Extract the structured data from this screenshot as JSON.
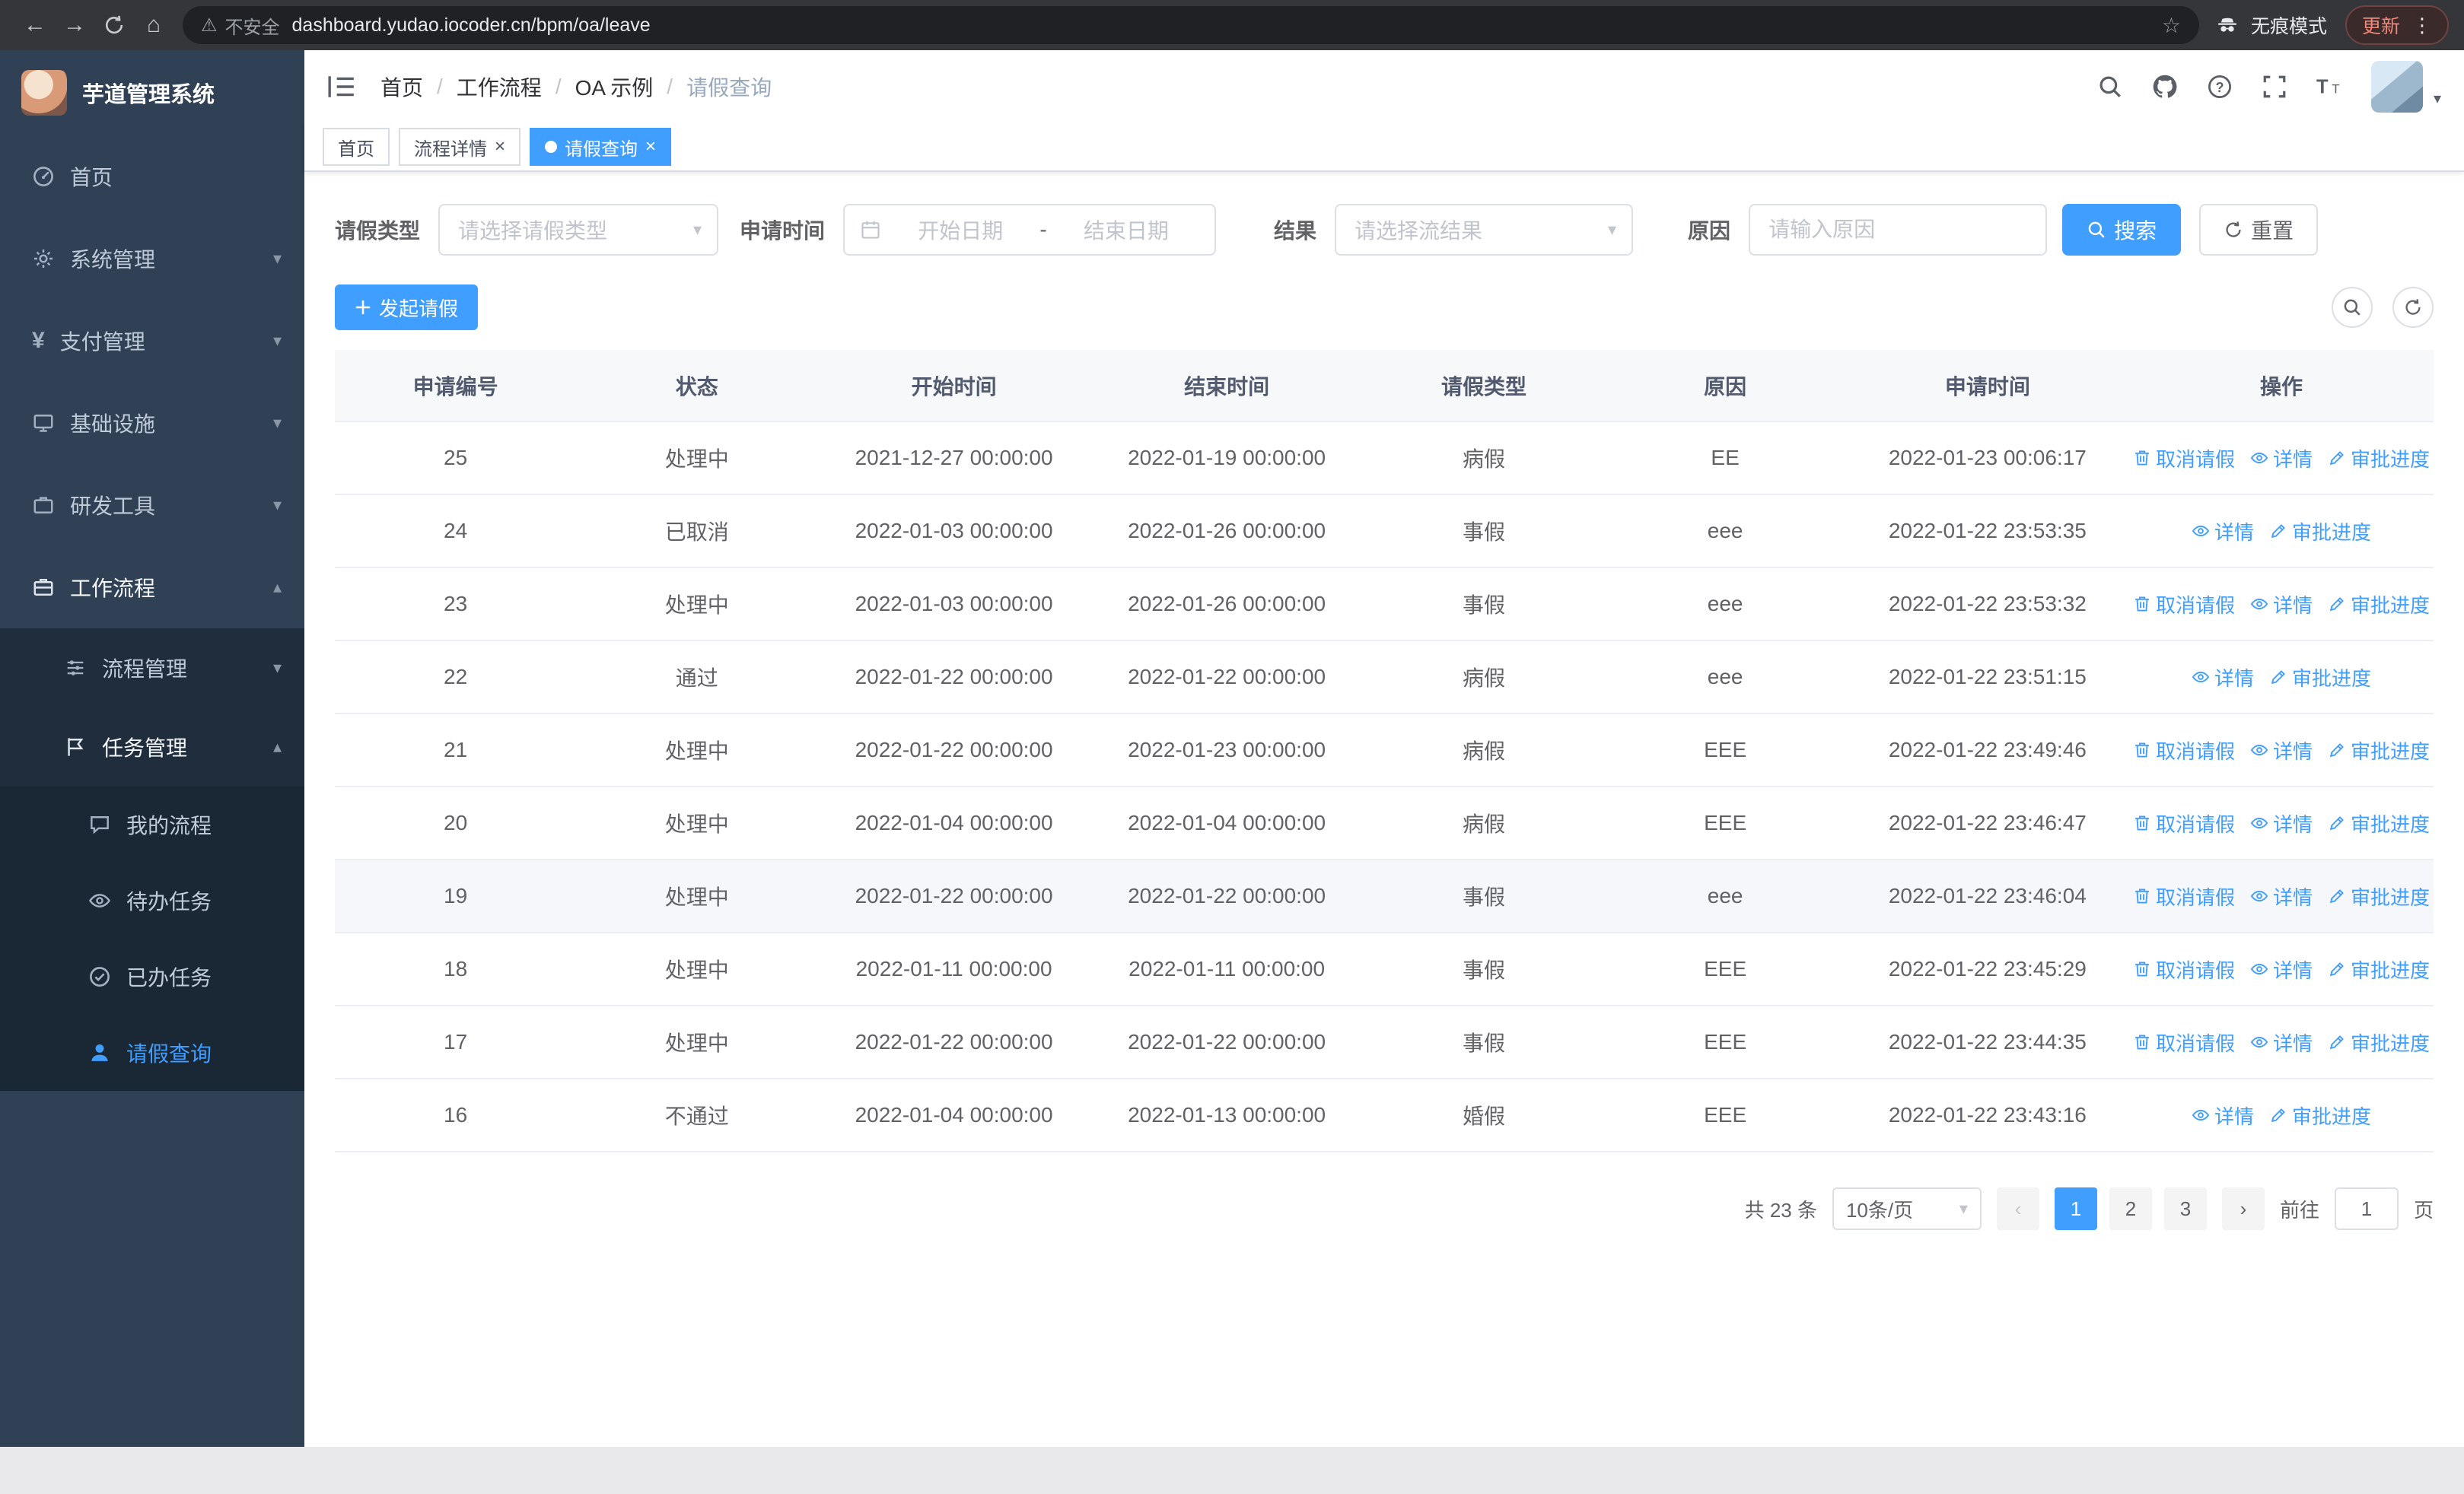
{
  "browser": {
    "security_warning": "不安全",
    "url": "dashboard.yudao.iocoder.cn/bpm/oa/leave",
    "incognito_label": "无痕模式",
    "update_label": "更新"
  },
  "sidebar": {
    "logo_title": "芋道管理系统",
    "menu": [
      {
        "key": "home",
        "label": "首页",
        "icon": "dashboard"
      },
      {
        "key": "system",
        "label": "系统管理",
        "icon": "gear",
        "chevron": "down"
      },
      {
        "key": "payment",
        "label": "支付管理",
        "icon": "yen",
        "chevron": "down"
      },
      {
        "key": "infrastructure",
        "label": "基础设施",
        "icon": "infrastructure",
        "chevron": "down"
      },
      {
        "key": "devtools",
        "label": "研发工具",
        "icon": "devtools",
        "chevron": "down"
      },
      {
        "key": "workflow",
        "label": "工作流程",
        "icon": "workflow",
        "chevron": "up",
        "open": true
      }
    ],
    "workflow_submenu": [
      {
        "key": "process-mgmt",
        "label": "流程管理",
        "icon": "process",
        "chevron": "down"
      },
      {
        "key": "task-mgmt",
        "label": "任务管理",
        "icon": "task",
        "chevron": "up",
        "open": true
      }
    ],
    "task_children": [
      {
        "key": "my-processes",
        "label": "我的流程",
        "icon": "chat"
      },
      {
        "key": "todo-tasks",
        "label": "待办任务",
        "icon": "eye"
      },
      {
        "key": "done-tasks",
        "label": "已办任务",
        "icon": "done"
      },
      {
        "key": "leave-query",
        "label": "请假查询",
        "icon": "user",
        "active": true
      }
    ]
  },
  "header": {
    "breadcrumb": [
      "首页",
      "工作流程",
      "OA 示例",
      "请假查询"
    ]
  },
  "tabs": [
    {
      "key": "home",
      "label": "首页"
    },
    {
      "key": "process-detail",
      "label": "流程详情",
      "closable": true
    },
    {
      "key": "leave-query",
      "label": "请假查询",
      "closable": true,
      "active": true
    }
  ],
  "filters": {
    "leave_type_label": "请假类型",
    "leave_type_placeholder": "请选择请假类型",
    "apply_time_label": "申请时间",
    "start_date_placeholder": "开始日期",
    "range_separator": "-",
    "end_date_placeholder": "结束日期",
    "result_label": "结果",
    "result_placeholder": "请选择流结果",
    "reason_label": "原因",
    "reason_placeholder": "请输入原因",
    "search_button": "搜索",
    "reset_button": "重置"
  },
  "toolbar": {
    "create_button": "发起请假"
  },
  "table": {
    "columns": [
      "申请编号",
      "状态",
      "开始时间",
      "结束时间",
      "请假类型",
      "原因",
      "申请时间",
      "操作"
    ],
    "actions": {
      "cancel": "取消请假",
      "detail": "详情",
      "progress": "审批进度"
    },
    "rows": [
      {
        "id": "25",
        "status": "处理中",
        "start": "2021-12-27 00:00:00",
        "end": "2022-01-19 00:00:00",
        "type": "病假",
        "reason": "EE",
        "applied": "2022-01-23 00:06:17",
        "cancellable": true
      },
      {
        "id": "24",
        "status": "已取消",
        "start": "2022-01-03 00:00:00",
        "end": "2022-01-26 00:00:00",
        "type": "事假",
        "reason": "eee",
        "applied": "2022-01-22 23:53:35",
        "cancellable": false
      },
      {
        "id": "23",
        "status": "处理中",
        "start": "2022-01-03 00:00:00",
        "end": "2022-01-26 00:00:00",
        "type": "事假",
        "reason": "eee",
        "applied": "2022-01-22 23:53:32",
        "cancellable": true
      },
      {
        "id": "22",
        "status": "通过",
        "start": "2022-01-22 00:00:00",
        "end": "2022-01-22 00:00:00",
        "type": "病假",
        "reason": "eee",
        "applied": "2022-01-22 23:51:15",
        "cancellable": false
      },
      {
        "id": "21",
        "status": "处理中",
        "start": "2022-01-22 00:00:00",
        "end": "2022-01-23 00:00:00",
        "type": "病假",
        "reason": "EEE",
        "applied": "2022-01-22 23:49:46",
        "cancellable": true
      },
      {
        "id": "20",
        "status": "处理中",
        "start": "2022-01-04 00:00:00",
        "end": "2022-01-04 00:00:00",
        "type": "病假",
        "reason": "EEE",
        "applied": "2022-01-22 23:46:47",
        "cancellable": true
      },
      {
        "id": "19",
        "status": "处理中",
        "start": "2022-01-22 00:00:00",
        "end": "2022-01-22 00:00:00",
        "type": "事假",
        "reason": "eee",
        "applied": "2022-01-22 23:46:04",
        "cancellable": true,
        "hover": true
      },
      {
        "id": "18",
        "status": "处理中",
        "start": "2022-01-11 00:00:00",
        "end": "2022-01-11 00:00:00",
        "type": "事假",
        "reason": "EEE",
        "applied": "2022-01-22 23:45:29",
        "cancellable": true
      },
      {
        "id": "17",
        "status": "处理中",
        "start": "2022-01-22 00:00:00",
        "end": "2022-01-22 00:00:00",
        "type": "事假",
        "reason": "EEE",
        "applied": "2022-01-22 23:44:35",
        "cancellable": true
      },
      {
        "id": "16",
        "status": "不通过",
        "start": "2022-01-04 00:00:00",
        "end": "2022-01-13 00:00:00",
        "type": "婚假",
        "reason": "EEE",
        "applied": "2022-01-22 23:43:16",
        "cancellable": false
      }
    ]
  },
  "pagination": {
    "total_text": "共 23 条",
    "page_size": "10条/页",
    "pages": [
      "1",
      "2",
      "3"
    ],
    "active_page": "1",
    "goto_label": "前往",
    "goto_value": "1",
    "goto_suffix": "页"
  }
}
